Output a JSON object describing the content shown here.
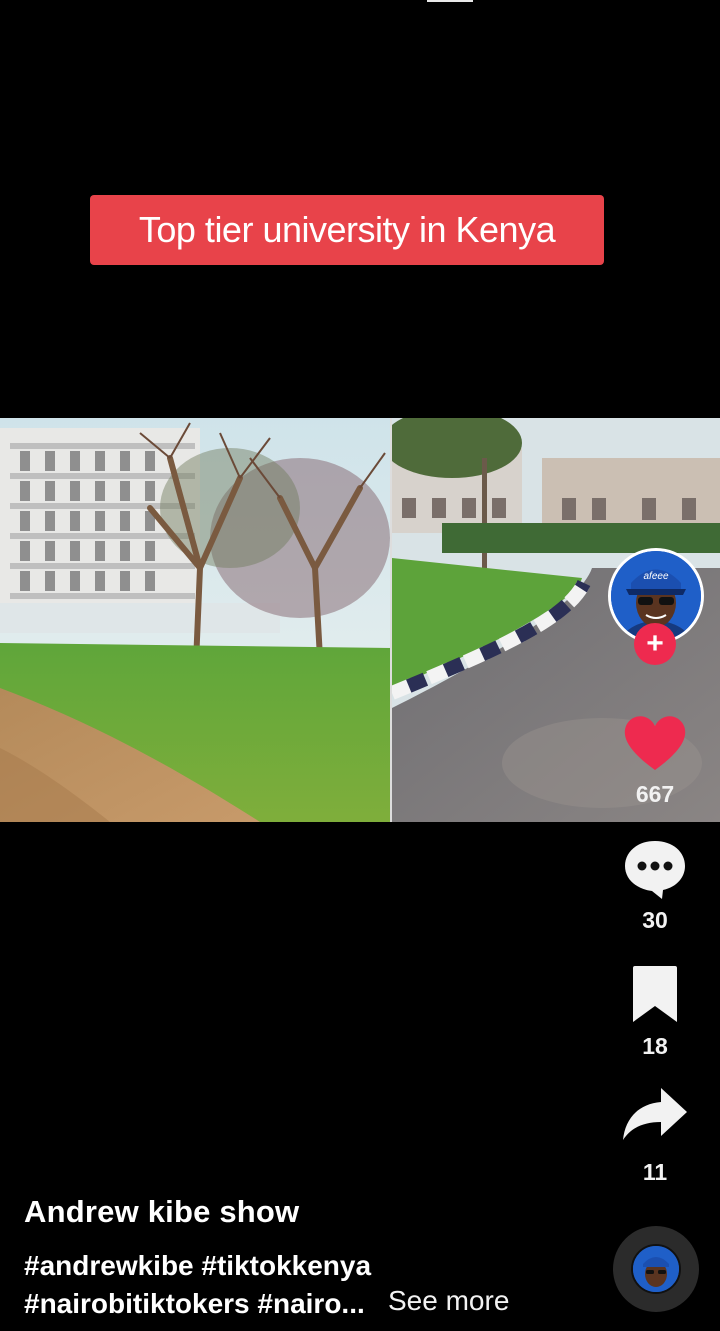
{
  "video": {
    "caption": "Top tier university in Kenya"
  },
  "rail": {
    "likes": "667",
    "comments": "30",
    "saves": "18",
    "shares": "11",
    "follow_symbol": "+"
  },
  "post": {
    "author": "Andrew kibe show",
    "hashtags_line1": "#andrewkibe #tiktokkenya",
    "hashtags_line2": "#nairobitiktokers #nairo...",
    "see_more": "See more"
  },
  "colors": {
    "banner": "#e8434a",
    "like": "#ee2a4f",
    "follow": "#ee2a4f",
    "background": "#000000"
  },
  "icons": [
    "heart-icon",
    "comment-icon",
    "bookmark-icon",
    "share-icon",
    "plus-icon"
  ]
}
